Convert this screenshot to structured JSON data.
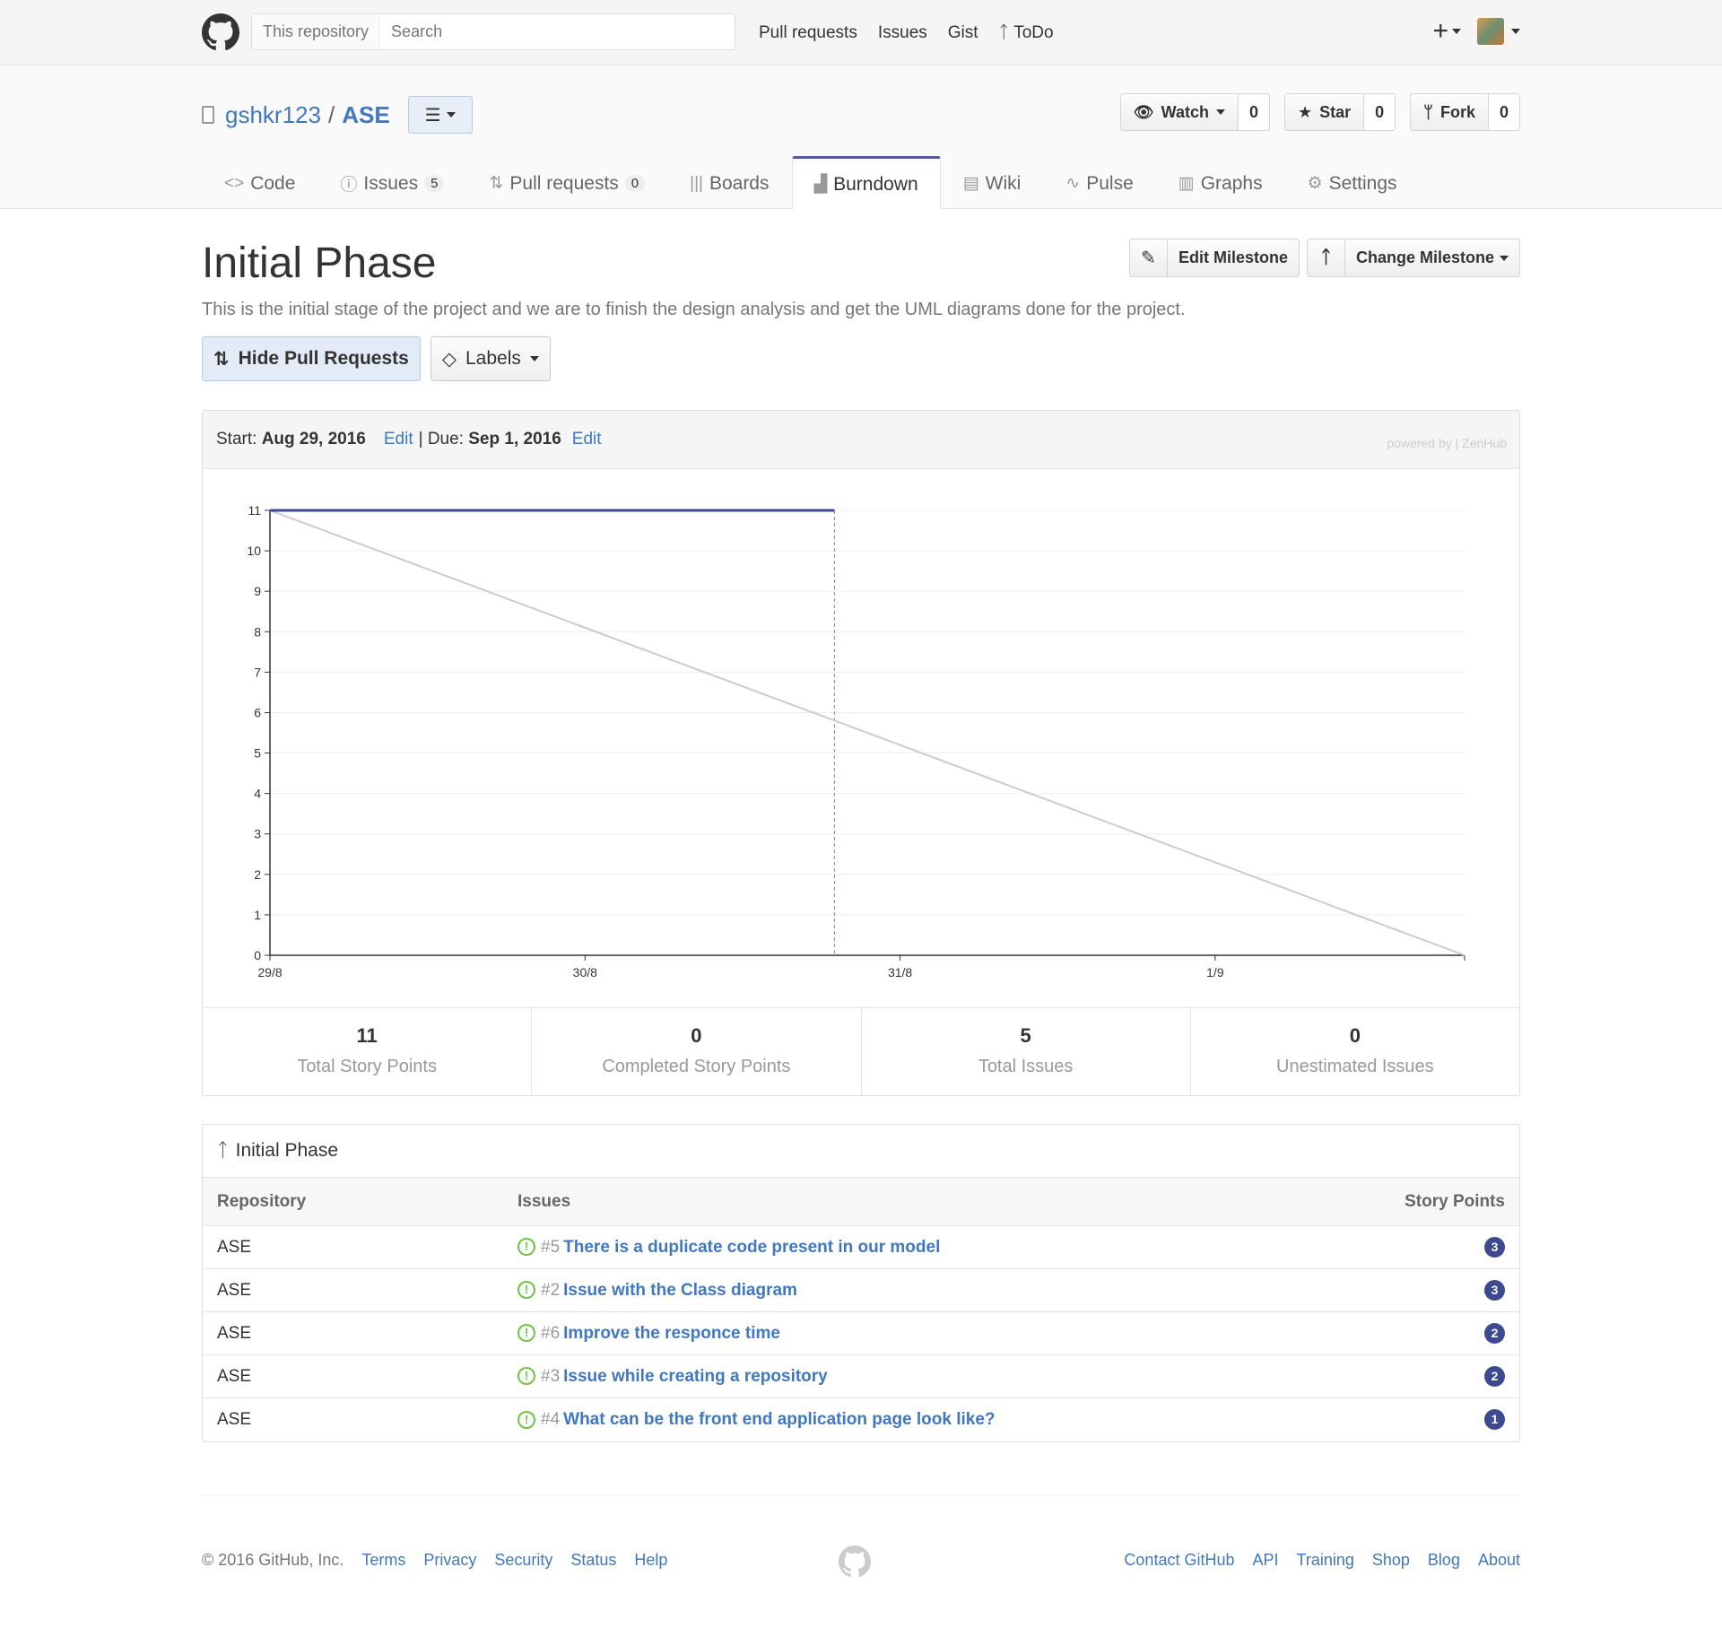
{
  "header": {
    "search_scope": "This repository",
    "search_placeholder": "Search",
    "nav": [
      "Pull requests",
      "Issues",
      "Gist",
      "ToDo"
    ],
    "plus_label": "+"
  },
  "repo": {
    "owner": "gshkr123",
    "separator": "/",
    "name": "ASE",
    "watch_label": "Watch",
    "watch_count": "0",
    "star_label": "Star",
    "star_count": "0",
    "fork_label": "Fork",
    "fork_count": "0",
    "tabs": [
      {
        "label": "Code",
        "icon": "<>",
        "counter": ""
      },
      {
        "label": "Issues",
        "icon": "!",
        "counter": "5"
      },
      {
        "label": "Pull requests",
        "icon": "pr",
        "counter": "0"
      },
      {
        "label": "Boards",
        "icon": "boards",
        "counter": ""
      },
      {
        "label": "Burndown",
        "icon": "burndown",
        "counter": ""
      },
      {
        "label": "Wiki",
        "icon": "wiki",
        "counter": ""
      },
      {
        "label": "Pulse",
        "icon": "pulse",
        "counter": ""
      },
      {
        "label": "Graphs",
        "icon": "graphs",
        "counter": ""
      },
      {
        "label": "Settings",
        "icon": "gear",
        "counter": ""
      }
    ]
  },
  "milestone": {
    "title": "Initial Phase",
    "description": "This is the initial stage of the project and we are to finish the design analysis and get the UML diagrams done for the project.",
    "edit_label": "Edit Milestone",
    "change_label": "Change Milestone",
    "hide_pr_label": "Hide Pull Requests",
    "labels_label": "Labels"
  },
  "burndown": {
    "start_prefix": "Start:",
    "start_date": "Aug 29, 2016",
    "edit1": "Edit",
    "due_prefix": "| Due:",
    "due_date": "Sep 1, 2016",
    "edit2": "Edit",
    "powered": "powered by | ZenHub"
  },
  "chart_data": {
    "type": "line",
    "x_ticks": [
      "29/8",
      "30/8",
      "31/8",
      "1/9"
    ],
    "x_range": [
      "2016-08-29",
      "2016-09-01 19:00"
    ],
    "ylim": [
      0,
      11
    ],
    "y_ticks": [
      0,
      1,
      2,
      3,
      4,
      5,
      6,
      7,
      8,
      9,
      10,
      11
    ],
    "grid": true,
    "series": [
      {
        "role": "ideal",
        "color": "#cccccc",
        "points": [
          [
            "2016-08-29",
            11
          ],
          [
            "2016-09-01 19:00",
            0
          ]
        ]
      },
      {
        "role": "remaining",
        "color": "#3e4a8f",
        "points": [
          [
            "2016-08-29",
            11
          ],
          [
            "2016-08-30 19:00",
            11
          ]
        ]
      }
    ],
    "today_marker": "2016-08-30 19:00"
  },
  "stats": [
    {
      "value": "11",
      "label": "Total Story Points"
    },
    {
      "value": "0",
      "label": "Completed Story Points"
    },
    {
      "value": "5",
      "label": "Total Issues"
    },
    {
      "value": "0",
      "label": "Unestimated Issues"
    }
  ],
  "issues_table": {
    "title": "Initial Phase",
    "headers": {
      "repo": "Repository",
      "issues": "Issues",
      "points": "Story Points"
    },
    "rows": [
      {
        "repo": "ASE",
        "num": "#5",
        "title": "There is a duplicate code present in our model",
        "points": "3"
      },
      {
        "repo": "ASE",
        "num": "#2",
        "title": "Issue with the Class diagram",
        "points": "3"
      },
      {
        "repo": "ASE",
        "num": "#6",
        "title": "Improve the responce time",
        "points": "2"
      },
      {
        "repo": "ASE",
        "num": "#3",
        "title": "Issue while creating a repository",
        "points": "2"
      },
      {
        "repo": "ASE",
        "num": "#4",
        "title": "What can be the front end application page look like?",
        "points": "1"
      }
    ]
  },
  "footer": {
    "copyright": "© 2016 GitHub, Inc.",
    "left_links": [
      "Terms",
      "Privacy",
      "Security",
      "Status",
      "Help"
    ],
    "right_links": [
      "Contact GitHub",
      "API",
      "Training",
      "Shop",
      "Blog",
      "About"
    ]
  },
  "colors": {
    "accent": "#4078c0",
    "burndown": "#3e4a8f",
    "ideal": "#cccccc",
    "open_issue": "#6cc644"
  }
}
